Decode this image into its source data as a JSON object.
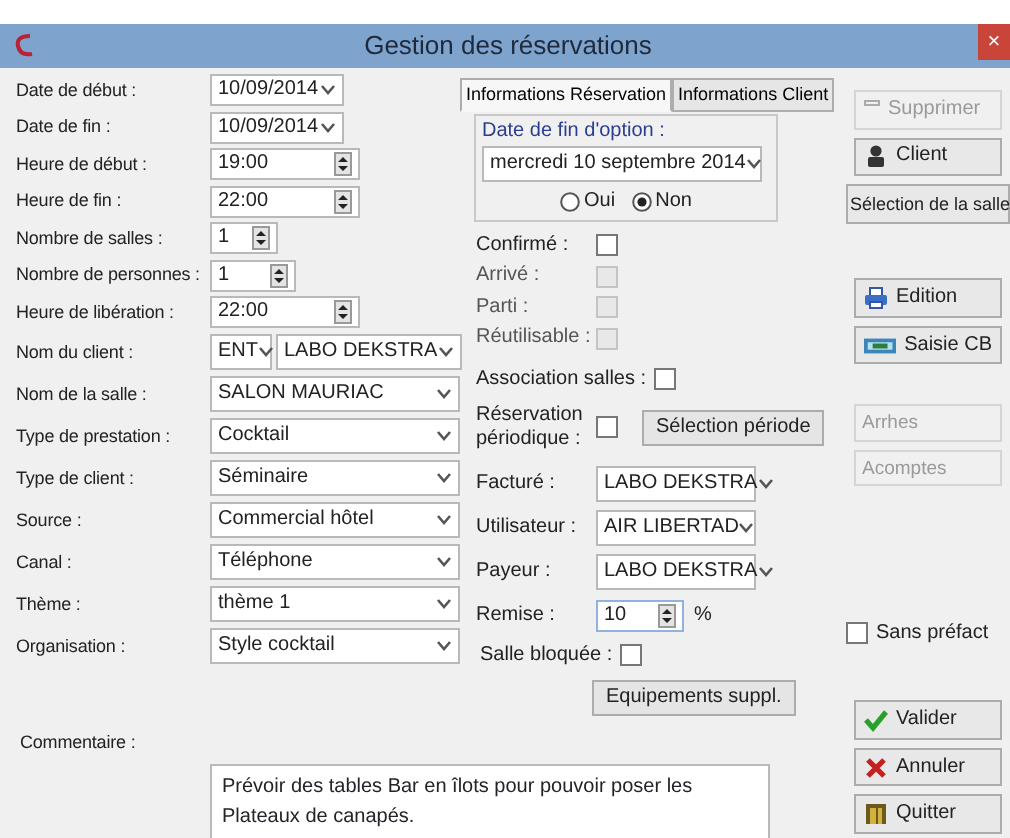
{
  "window": {
    "title": "Gestion des réservations",
    "close": "×"
  },
  "left_fields": [
    {
      "kind": "date",
      "label": "Date de début :",
      "value": "10/09/2014"
    },
    {
      "kind": "date",
      "label": "Date de fin :",
      "value": "10/09/2014"
    },
    {
      "kind": "spin",
      "label": "Heure de début :",
      "value": "19:00"
    },
    {
      "kind": "spin",
      "label": "Heure de fin :",
      "value": "22:00"
    },
    {
      "kind": "smallspin",
      "label": "Nombre de salles :",
      "value": "1"
    },
    {
      "kind": "smallspin",
      "label": "Nombre de personnes :",
      "value": "1"
    },
    {
      "kind": "spin",
      "label": "Heure de libération :",
      "value": "22:00"
    },
    {
      "kind": "client",
      "label": "Nom du client :",
      "prefix": "ENT",
      "value": "LABO DEKSTRA"
    },
    {
      "kind": "combo",
      "label": "Nom de la salle :",
      "value": "SALON MAURIAC"
    },
    {
      "kind": "combo",
      "label": "Type de prestation :",
      "value": "Cocktail"
    },
    {
      "kind": "combo",
      "label": "Type de client :",
      "value": "Séminaire"
    },
    {
      "kind": "combo",
      "label": "Source :",
      "value": "Commercial hôtel"
    },
    {
      "kind": "combo",
      "label": "Canal :",
      "value": "Téléphone"
    },
    {
      "kind": "combo",
      "label": "Thème :",
      "value": "thème 1"
    },
    {
      "kind": "combo",
      "label": "Organisation :",
      "value": "Style cocktail"
    }
  ],
  "comment": {
    "label": "Commentaire :",
    "value": "Prévoir des tables Bar en îlots pour pouvoir poser les Plateaux de canapés."
  },
  "tabs": [
    {
      "label": "Informations Réservation",
      "selected": true
    },
    {
      "label": "Informations Client",
      "selected": false
    }
  ],
  "option": {
    "label": "Date de fin d'option :",
    "value": "mercredi  10 septembre 2014",
    "radios": [
      {
        "label": "Oui",
        "selected": false
      },
      {
        "label": "Non",
        "selected": true
      }
    ]
  },
  "checks": [
    {
      "label": "Confirmé :",
      "checked": false,
      "disabled": false
    },
    {
      "label": "Arrivé :",
      "checked": false,
      "disabled": true
    },
    {
      "label": "Parti :",
      "checked": false,
      "disabled": true
    },
    {
      "label": "Réutilisable :",
      "checked": false,
      "disabled": true
    }
  ],
  "association": {
    "label": "Association salles :",
    "checked": false
  },
  "periodic": {
    "label": "Réservation périodique :",
    "checked": false,
    "button": "Sélection période"
  },
  "right_fields": [
    {
      "kind": "combo",
      "label": "Facturé :",
      "value": "LABO DEKSTRA"
    },
    {
      "kind": "combo",
      "label": "Utilisateur :",
      "value": "AIR LIBERTAD"
    },
    {
      "kind": "combo",
      "label": "Payeur :",
      "value": "LABO DEKSTRA"
    },
    {
      "kind": "spin",
      "label": "Remise :",
      "value": "10",
      "unit": "%"
    }
  ],
  "salle_bloquee": {
    "label": "Salle bloquée :",
    "checked": false
  },
  "equipements_button": "Equipements suppl.",
  "side_top": [
    {
      "label": "Supprimer",
      "disabled": true
    },
    {
      "label": "Client",
      "disabled": false
    },
    {
      "label": "Sélection de la salle",
      "disabled": false
    }
  ],
  "side_mid": [
    {
      "label": "Edition",
      "disabled": false
    },
    {
      "label": "Saisie CB",
      "disabled": false
    }
  ],
  "side_fields": [
    {
      "placeholder": "Arrhes"
    },
    {
      "placeholder": "Acomptes"
    }
  ],
  "sans_prefact": {
    "label": "Sans préfact",
    "checked": false
  },
  "bottom_buttons": [
    {
      "label": "Valider"
    },
    {
      "label": "Annuler"
    },
    {
      "label": "Quitter"
    }
  ]
}
